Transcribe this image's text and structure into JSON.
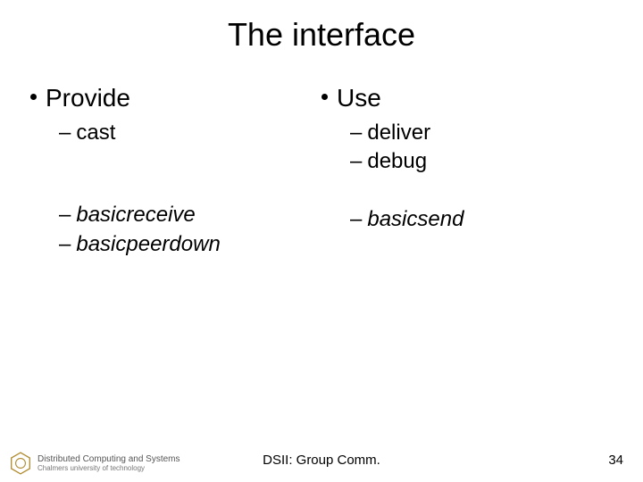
{
  "title": "The interface",
  "left": {
    "heading": "Provide",
    "group1": [
      "cast"
    ],
    "group2": [
      "basicreceive",
      "basicpeerdown"
    ]
  },
  "right": {
    "heading": "Use",
    "group1": [
      "deliver",
      "debug"
    ],
    "group2": [
      "basicsend"
    ]
  },
  "footer": {
    "center": "DSII: Group Comm.",
    "page": "34",
    "org_line1": "Distributed Computing and Systems",
    "org_line2": "Chalmers university of technology"
  }
}
